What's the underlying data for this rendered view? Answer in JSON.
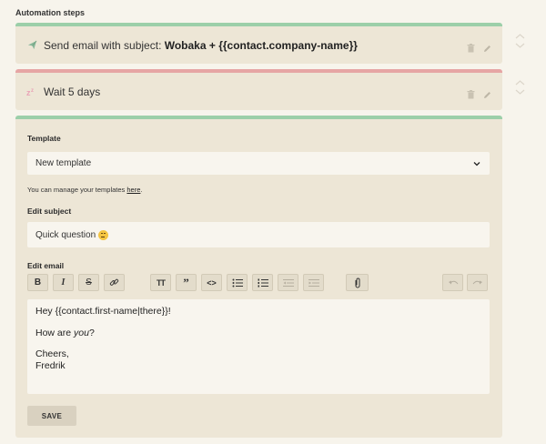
{
  "section_title": "Automation steps",
  "steps": [
    {
      "prefix": "Send email with subject: ",
      "bold": "Wobaka + {{contact.company-name}}",
      "icon": "paper-plane-icon",
      "status_color": "#9ccfa9"
    },
    {
      "prefix": "Wait 5 days",
      "bold": "",
      "icon": "sleep-zz-icon",
      "status_color": "#e6a5a4"
    }
  ],
  "editor_card": {
    "template_label": "Template",
    "template_value": "New template",
    "help_text": "You can manage your templates ",
    "help_link": "here",
    "help_suffix": ".",
    "subject_label": "Edit subject",
    "subject_value": "Quick question",
    "email_label": "Edit email",
    "toolbar": {
      "bold": "B",
      "italic": "I",
      "strike": "S",
      "heading": "TT",
      "quote": "”",
      "code": "<>"
    },
    "body_lines": {
      "line1": "Hey {{contact.first-name|there}}!",
      "line2_a": "How are ",
      "line2_b": "you",
      "line2_c": "?",
      "line3": "Cheers,",
      "line4": "Fredrik"
    },
    "save_label": "SAVE"
  },
  "colors": {
    "card_bg": "#ede6d6",
    "page_bg": "#f7f4ec",
    "success_bar": "#9ccfa9",
    "wait_bar": "#e6a5a4"
  }
}
